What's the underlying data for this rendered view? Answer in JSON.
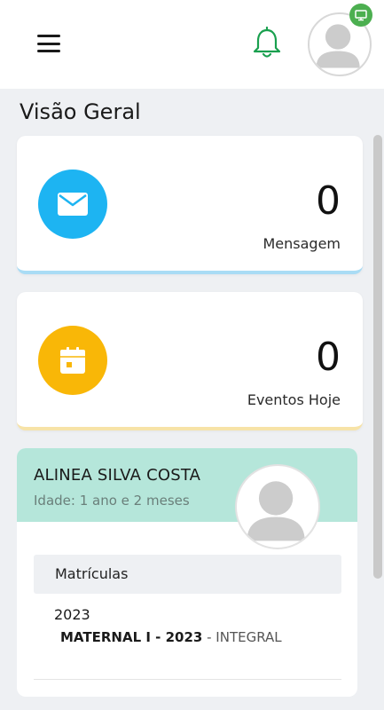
{
  "header": {
    "menu_icon": "hamburger-menu-icon",
    "notification_icon": "bell-icon",
    "avatar_icon": "user-avatar-icon",
    "status_icon": "monitor-icon",
    "status_color": "#4caf50",
    "bell_color": "#1aa04f"
  },
  "page": {
    "title": "Visão Geral"
  },
  "cards": {
    "messages": {
      "value": "0",
      "label": "Mensagem",
      "icon": "envelope-icon",
      "color": "#1db4f2"
    },
    "events": {
      "value": "0",
      "label": "Eventos Hoje",
      "icon": "calendar-icon",
      "color": "#f9b707"
    }
  },
  "student": {
    "name": "ALINEA SILVA COSTA",
    "age": "Idade: 1 ano e 2 meses",
    "header_color": "#b5e6da",
    "enrollments": {
      "title": "Matrículas",
      "year": "2023",
      "class_name": "MATERNAL I - 2023",
      "separator": " - ",
      "period": "INTEGRAL"
    }
  }
}
